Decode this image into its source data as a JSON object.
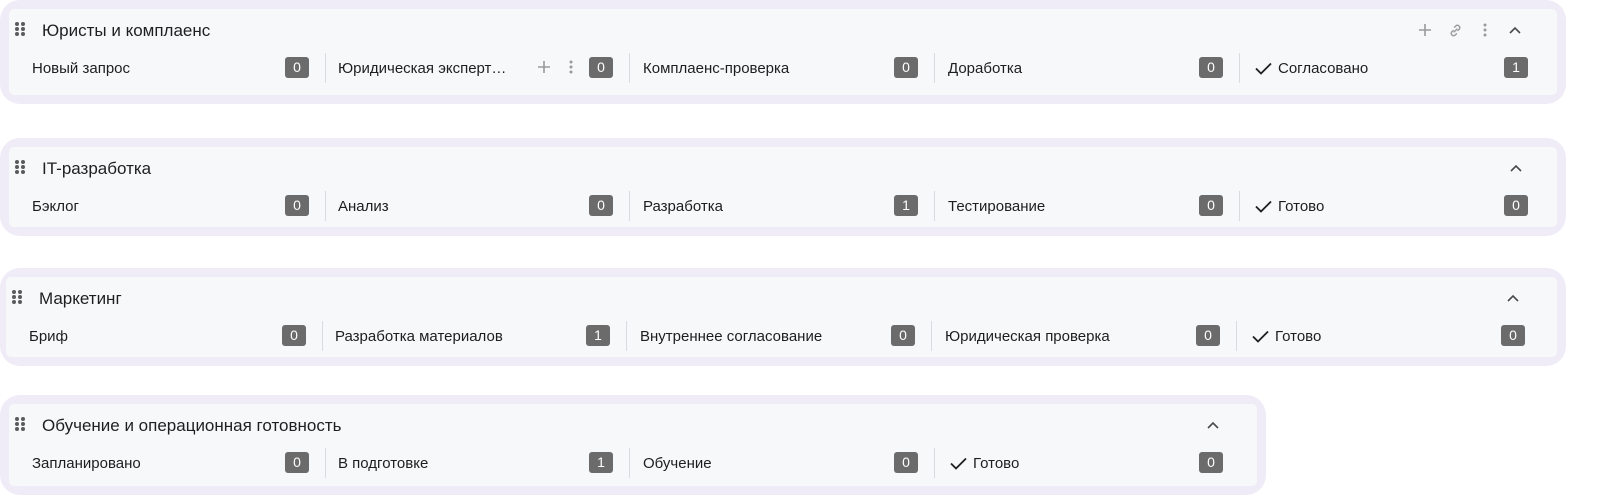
{
  "colors": {
    "frame": "#efecf7",
    "panel": "#f7f8fa",
    "count_badge": "#6b6b6b",
    "icon": "#9a9a9a"
  },
  "groups": [
    {
      "title": "Юристы и комплаенс",
      "actions": [
        "plus-icon",
        "link-icon",
        "more-vertical-icon",
        "chevron-up-icon"
      ],
      "columns": [
        {
          "label": "Новый запрос",
          "count": "0"
        },
        {
          "label": "Юридическая эксперт…",
          "count": "0",
          "hover_actions": [
            "plus-icon",
            "more-vertical-icon"
          ]
        },
        {
          "label": "Комплаенс-проверка",
          "count": "0"
        },
        {
          "label": "Доработка",
          "count": "0"
        },
        {
          "label": "Согласовано",
          "count": "1",
          "done": true
        }
      ]
    },
    {
      "title": "IT-разработка",
      "actions": [
        "chevron-up-icon"
      ],
      "columns": [
        {
          "label": "Бэклог",
          "count": "0"
        },
        {
          "label": "Анализ",
          "count": "0"
        },
        {
          "label": "Разработка",
          "count": "1"
        },
        {
          "label": "Тестирование",
          "count": "0"
        },
        {
          "label": "Готово",
          "count": "0",
          "done": true
        }
      ]
    },
    {
      "title": "Маркетинг",
      "actions": [
        "chevron-up-icon"
      ],
      "columns": [
        {
          "label": "Бриф",
          "count": "0"
        },
        {
          "label": "Разработка материалов",
          "count": "1"
        },
        {
          "label": "Внутреннее согласование",
          "count": "0"
        },
        {
          "label": "Юридическая проверка",
          "count": "0"
        },
        {
          "label": "Готово",
          "count": "0",
          "done": true
        }
      ]
    },
    {
      "title": "Обучение и операционная готовность",
      "actions": [
        "chevron-up-icon"
      ],
      "columns": [
        {
          "label": "Запланировано",
          "count": "0"
        },
        {
          "label": "В подготовке",
          "count": "1"
        },
        {
          "label": "Обучение",
          "count": "0"
        },
        {
          "label": "Готово",
          "count": "0",
          "done": true
        }
      ]
    }
  ]
}
